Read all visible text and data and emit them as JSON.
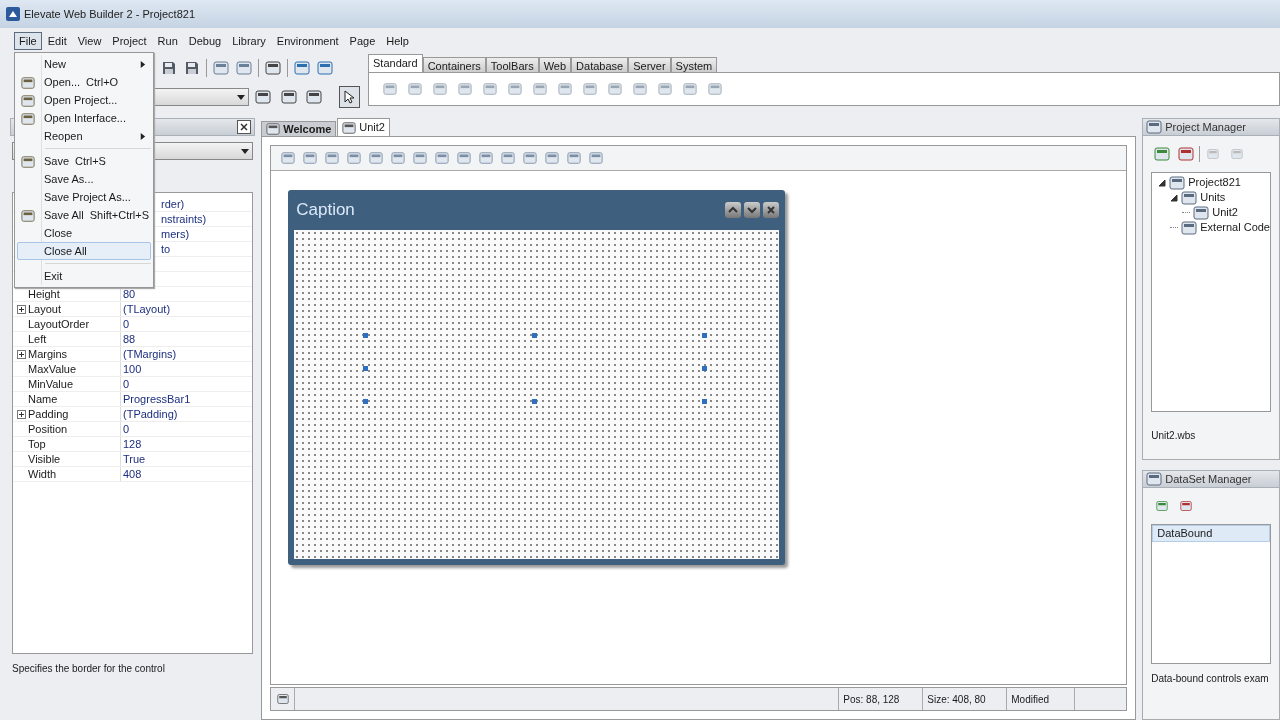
{
  "window": {
    "title": "Elevate Web Builder 2 - Project821"
  },
  "menubar": [
    {
      "label": "File",
      "selected": true
    },
    {
      "label": "Edit",
      "selected": false
    },
    {
      "label": "View",
      "selected": false
    },
    {
      "label": "Project",
      "selected": false
    },
    {
      "label": "Run",
      "selected": false
    },
    {
      "label": "Debug",
      "selected": false
    },
    {
      "label": "Library",
      "selected": false
    },
    {
      "label": "Environment",
      "selected": false
    },
    {
      "label": "Page",
      "selected": false
    },
    {
      "label": "Help",
      "selected": false
    }
  ],
  "file_menu": [
    {
      "kind": "item",
      "label": "New",
      "submenu": true,
      "has_icon": false,
      "selected": false
    },
    {
      "kind": "item",
      "label": "Open...",
      "shortcut": "Ctrl+O",
      "submenu": false,
      "has_icon": true,
      "selected": false
    },
    {
      "kind": "item",
      "label": "Open Project...",
      "submenu": false,
      "has_icon": true,
      "selected": false
    },
    {
      "kind": "item",
      "label": "Open Interface...",
      "submenu": false,
      "has_icon": true,
      "selected": false
    },
    {
      "kind": "item",
      "label": "Reopen",
      "submenu": true,
      "has_icon": false,
      "selected": false
    },
    {
      "kind": "separator"
    },
    {
      "kind": "item",
      "label": "Save",
      "shortcut": "Ctrl+S",
      "submenu": false,
      "has_icon": true,
      "selected": false
    },
    {
      "kind": "item",
      "label": "Save As...",
      "submenu": false,
      "has_icon": false,
      "selected": false
    },
    {
      "kind": "item",
      "label": "Save Project As...",
      "submenu": false,
      "has_icon": false,
      "selected": false
    },
    {
      "kind": "item",
      "label": "Save All",
      "shortcut": "Shift+Ctrl+S",
      "submenu": false,
      "has_icon": true,
      "selected": false
    },
    {
      "kind": "item",
      "label": "Close",
      "submenu": false,
      "has_icon": false,
      "selected": false
    },
    {
      "kind": "item",
      "label": "Close All",
      "submenu": false,
      "has_icon": false,
      "selected": true
    },
    {
      "kind": "separator"
    },
    {
      "kind": "item",
      "label": "Exit",
      "submenu": false,
      "has_icon": false,
      "selected": false
    }
  ],
  "palette": {
    "tabs": [
      {
        "label": "Standard",
        "selected": true
      },
      {
        "label": "Containers",
        "selected": false
      },
      {
        "label": "ToolBars",
        "selected": false
      },
      {
        "label": "Web",
        "selected": false
      },
      {
        "label": "Database",
        "selected": false
      },
      {
        "label": "Server",
        "selected": false
      },
      {
        "label": "System",
        "selected": false
      }
    ]
  },
  "properties": {
    "rows": [
      {
        "kind": "covered",
        "value": "rder)"
      },
      {
        "kind": "covered",
        "value": "nstraints)"
      },
      {
        "kind": "covered",
        "value": "mers)"
      },
      {
        "kind": "covered",
        "value": "to"
      },
      {
        "kind": "hidden"
      },
      {
        "kind": "hidden"
      },
      {
        "kind": "row",
        "name": "Height",
        "value": "80"
      },
      {
        "kind": "row",
        "name": "Layout",
        "value": "(TLayout)",
        "expanded": false
      },
      {
        "kind": "row",
        "name": "LayoutOrder",
        "value": "0"
      },
      {
        "kind": "row",
        "name": "Left",
        "value": "88"
      },
      {
        "kind": "row",
        "name": "Margins",
        "value": "(TMargins)",
        "expanded": false
      },
      {
        "kind": "row",
        "name": "MaxValue",
        "value": "100"
      },
      {
        "kind": "row",
        "name": "MinValue",
        "value": "0"
      },
      {
        "kind": "row",
        "name": "Name",
        "value": "ProgressBar1"
      },
      {
        "kind": "row",
        "name": "Padding",
        "value": "(TPadding)",
        "expanded": false
      },
      {
        "kind": "row",
        "name": "Position",
        "value": "0"
      },
      {
        "kind": "row",
        "name": "Top",
        "value": "128"
      },
      {
        "kind": "row",
        "name": "Visible",
        "value": "True"
      },
      {
        "kind": "row",
        "name": "Width",
        "value": "408"
      }
    ],
    "description": "Specifies the border for the control"
  },
  "editor_tabs": [
    {
      "label": "Welcome",
      "selected": false
    },
    {
      "label": "Unit2",
      "selected": true
    }
  ],
  "form": {
    "caption": "Caption"
  },
  "status_bar": {
    "position": "Pos: 88, 128",
    "size": "Size: 408, 80",
    "state": "Modified"
  },
  "project_manager": {
    "title": "Project Manager",
    "tree": [
      {
        "label": "Project821",
        "expanded": true,
        "children": [
          {
            "label": "Units",
            "expanded": true,
            "children": [
              {
                "label": "Unit2"
              }
            ]
          },
          {
            "label": "External Code"
          }
        ]
      }
    ],
    "file": "Unit2.wbs"
  },
  "dataset_manager": {
    "title": "DataSet Manager",
    "items": [
      {
        "label": "DataBound",
        "selected": true
      }
    ],
    "description": "Data-bound controls exam"
  }
}
